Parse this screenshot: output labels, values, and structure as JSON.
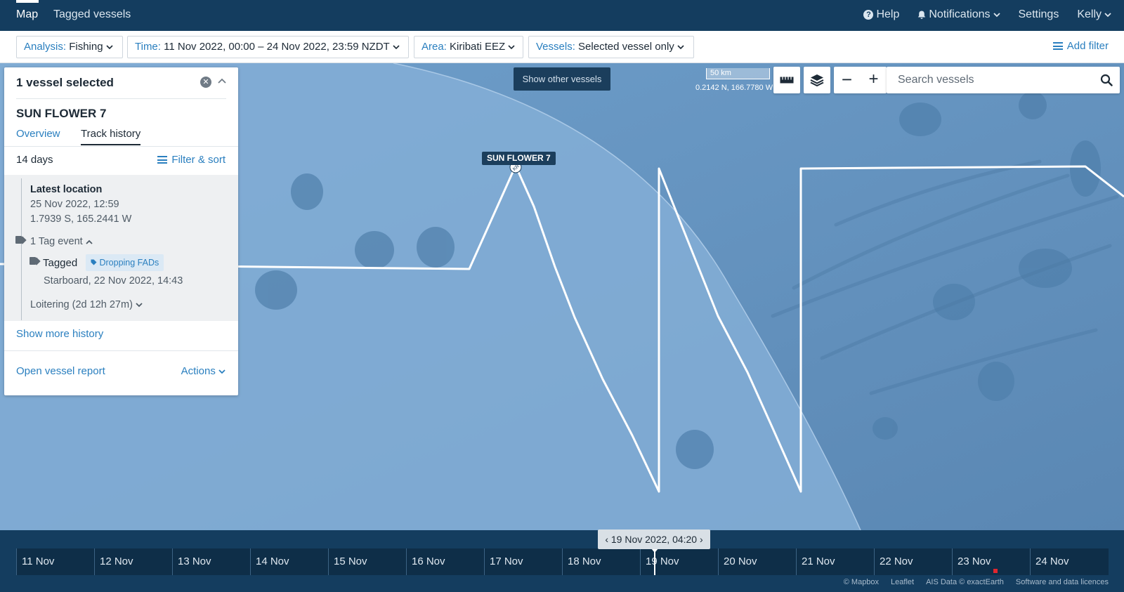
{
  "topnav": {
    "map_label": "Map",
    "tagged_label": "Tagged vessels",
    "help_label": "Help",
    "notifications_label": "Notifications",
    "settings_label": "Settings",
    "user_label": "Kelly"
  },
  "filters": {
    "analysis_key": "Analysis:",
    "analysis_value": "Fishing",
    "time_key": "Time:",
    "time_value": "11 Nov 2022, 00:00 – 24 Nov 2022, 23:59 NZDT",
    "area_key": "Area:",
    "area_value": "Kiribati EEZ",
    "vessels_key": "Vessels:",
    "vessels_value": "Selected vessel only",
    "add_filter_label": "Add filter"
  },
  "panel": {
    "title": "1 vessel selected",
    "vessel_name": "SUN FLOWER 7",
    "tabs": [
      "Overview",
      "Track history"
    ],
    "period": "14 days",
    "filter_sort_label": "Filter & sort",
    "latest_label": "Latest location",
    "latest_date": "25 Nov 2022, 12:59",
    "latest_coords": "1.7939 S, 165.2441 W",
    "tag_event_label": "1 Tag event",
    "tagged_label": "Tagged",
    "tag_badge": "Dropping FADs",
    "tag_detail": "Starboard, 22 Nov 2022, 14:43",
    "loitering_label": "Loitering (2d 12h 27m)",
    "show_more_label": "Show more history",
    "open_report_label": "Open vessel report",
    "actions_label": "Actions"
  },
  "map": {
    "show_other_label": "Show other vessels",
    "scale_label": "50 km",
    "cursor_coords": "0.2142 N, 166.7780 W",
    "search_placeholder": "Search vessels",
    "vessel_tag": "SUN FLOWER 7",
    "vessel_marker_text": "KR",
    "zoom_out_label": "−",
    "zoom_in_label": "+"
  },
  "timeline": {
    "current_time": "19 Nov 2022, 04:20",
    "days": [
      "11 Nov",
      "12 Nov",
      "13 Nov",
      "14 Nov",
      "15 Nov",
      "16 Nov",
      "17 Nov",
      "18 Nov",
      "19 Nov",
      "20 Nov",
      "21 Nov",
      "22 Nov",
      "23 Nov",
      "24 Nov"
    ]
  },
  "footer": [
    "© Mapbox",
    "Leaflet",
    "AIS Data © exactEarth",
    "Software and data licences"
  ],
  "colors": {
    "nav_bg": "#143d5f",
    "accent": "#2a7fbf",
    "ocean": "#6a9ac7",
    "eez_fill": "#7aa7d1",
    "track": "#ffffff",
    "event_marker": "#e0262e"
  },
  "icons": [
    "help-icon",
    "bell-icon",
    "chevron-down-icon",
    "filter-lines-icon",
    "close-icon",
    "chevron-up-icon",
    "tag-icon",
    "ruler-icon",
    "layers-icon",
    "search-icon",
    "chevron-left-icon",
    "chevron-right-icon"
  ]
}
